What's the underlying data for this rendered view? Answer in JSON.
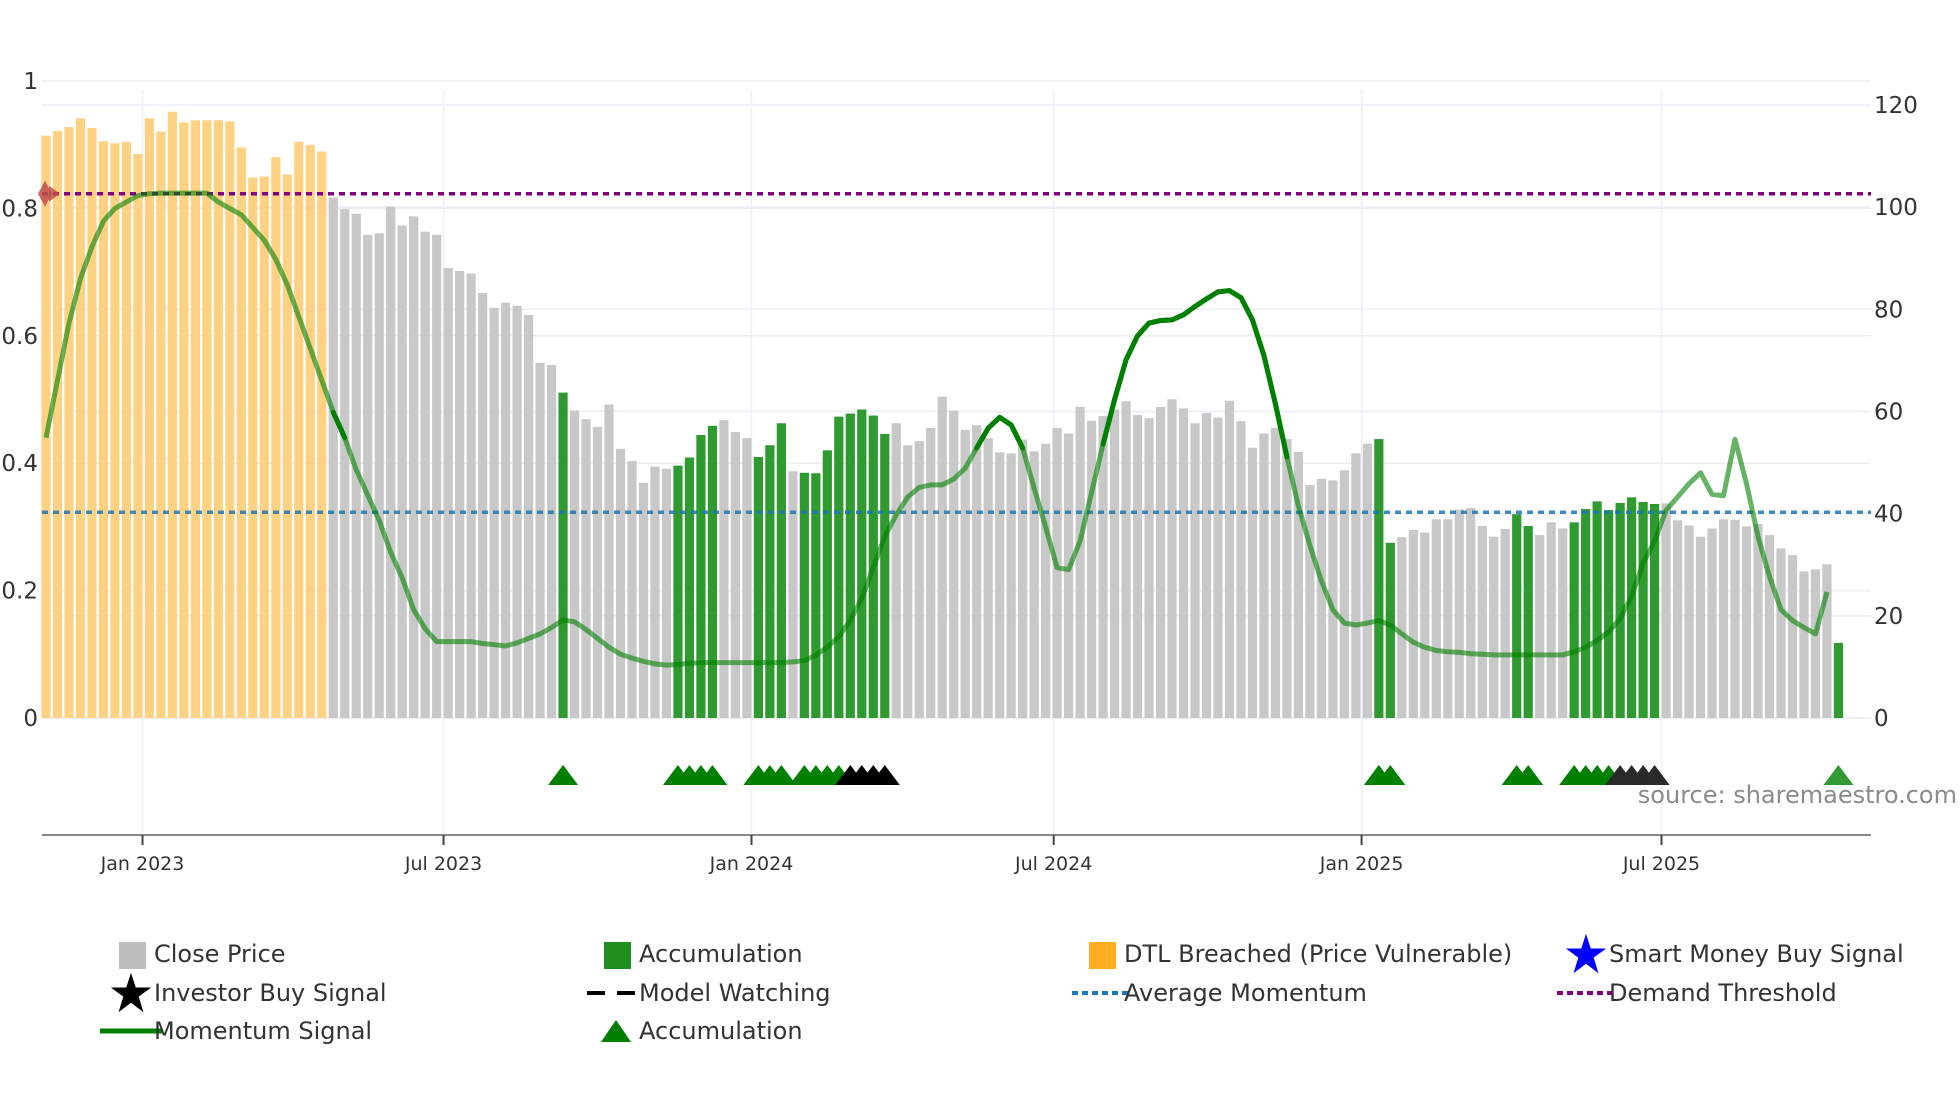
{
  "chart_data": {
    "type": "bar",
    "title": "",
    "x_unit": "week index",
    "x_ticks": [
      {
        "label": "Jan 2023",
        "index": 8.4
      },
      {
        "label": "Jul 2023",
        "index": 34.6
      },
      {
        "label": "Jan 2024",
        "index": 61.4
      },
      {
        "label": "Jul 2024",
        "index": 87.7
      },
      {
        "label": "Jan 2025",
        "index": 114.5
      },
      {
        "label": "Jul 2025",
        "index": 140.6
      }
    ],
    "y_left": {
      "ylim": [
        0,
        1
      ],
      "ticks": [
        "0",
        "0.2",
        "0.4",
        "0.6",
        "0.8",
        "1"
      ],
      "tick_values": [
        0,
        0.2,
        0.4,
        0.6,
        0.8,
        1
      ]
    },
    "y_right": {
      "ylim": [
        0,
        120
      ],
      "ticks": [
        "0",
        "20",
        "40",
        "60",
        "80",
        "100",
        "120"
      ],
      "tick_values": [
        0,
        20,
        40,
        60,
        80,
        100,
        120
      ]
    },
    "close_price": [
      114.0,
      114.9,
      115.7,
      117.4,
      115.5,
      112.9,
      112.5,
      112.8,
      110.4,
      117.4,
      114.8,
      118.7,
      116.6,
      117.0,
      117.0,
      117.0,
      116.8,
      111.7,
      105.8,
      106.0,
      109.8,
      106.4,
      112.8,
      112.2,
      110.9,
      101.9,
      99.6,
      98.7,
      94.6,
      94.9,
      100.1,
      96.4,
      98.2,
      95.2,
      94.6,
      88.1,
      87.5,
      87.0,
      83.2,
      80.3,
      81.3,
      80.7,
      78.9,
      69.5,
      69.1,
      63.7,
      60.2,
      58.5,
      57.0,
      61.4,
      52.7,
      50.3,
      46.0,
      49.2,
      48.8,
      49.4,
      51.0,
      55.4,
      57.2,
      58.3,
      56.0,
      54.8,
      51.1,
      53.4,
      57.7,
      48.3,
      48.0,
      47.9,
      52.4,
      59.0,
      59.6,
      60.4,
      59.2,
      55.6,
      57.7,
      53.4,
      54.2,
      56.8,
      62.9,
      60.2,
      56.4,
      57.3,
      54.8,
      52.0,
      51.8,
      54.5,
      52.2,
      53.7,
      56.8,
      55.7,
      60.9,
      58.2,
      59.1,
      60.4,
      62.0,
      59.3,
      58.7,
      60.9,
      62.4,
      60.6,
      57.7,
      59.7,
      58.8,
      62.1,
      58.1,
      52.9,
      55.7,
      56.8,
      54.6,
      52.1,
      45.6,
      46.8,
      46.5,
      48.5,
      51.8,
      53.7,
      54.6,
      34.3,
      35.4,
      36.8,
      36.3,
      38.9,
      38.9,
      40.8,
      41.1,
      37.6,
      35.5,
      37.0,
      39.9,
      37.6,
      35.8,
      38.3,
      37.1,
      38.3,
      40.9,
      42.4,
      40.7,
      42.1,
      43.2,
      42.3,
      41.9,
      42.0,
      38.7,
      37.7,
      35.5,
      37.1,
      38.9,
      38.8,
      37.5,
      38.0,
      35.8,
      33.2,
      31.9,
      28.7,
      29.1,
      30.1,
      14.7
    ],
    "dtl_breached_indices_range": [
      0,
      24
    ],
    "accumulation_indices": [
      45,
      55,
      56,
      57,
      58,
      62,
      63,
      64,
      66,
      67,
      68,
      69,
      70,
      71,
      72,
      73,
      116,
      117,
      128,
      129,
      133,
      134,
      135,
      136,
      137,
      138,
      139,
      140,
      156
    ],
    "investor_buy_indices": [
      70,
      71,
      72,
      73,
      137,
      138,
      139,
      140
    ],
    "momentum": [
      0.44,
      0.53,
      0.62,
      0.69,
      0.74,
      0.78,
      0.8,
      0.81,
      0.82,
      0.823,
      0.824,
      0.824,
      0.824,
      0.824,
      0.824,
      0.81,
      0.8,
      0.79,
      0.77,
      0.75,
      0.72,
      0.68,
      0.63,
      0.58,
      0.53,
      0.48,
      0.44,
      0.39,
      0.35,
      0.31,
      0.26,
      0.22,
      0.17,
      0.14,
      0.12,
      0.12,
      0.12,
      0.12,
      0.117,
      0.115,
      0.113,
      0.118,
      0.125,
      0.132,
      0.142,
      0.154,
      0.151,
      0.139,
      0.125,
      0.111,
      0.1,
      0.094,
      0.089,
      0.085,
      0.083,
      0.084,
      0.086,
      0.087,
      0.087,
      0.087,
      0.087,
      0.087,
      0.087,
      0.087,
      0.087,
      0.088,
      0.09,
      0.099,
      0.111,
      0.128,
      0.153,
      0.188,
      0.236,
      0.285,
      0.319,
      0.347,
      0.362,
      0.366,
      0.366,
      0.375,
      0.392,
      0.424,
      0.455,
      0.472,
      0.46,
      0.424,
      0.361,
      0.3,
      0.236,
      0.233,
      0.278,
      0.354,
      0.43,
      0.5,
      0.5625,
      0.6,
      0.62,
      0.624,
      0.625,
      0.633,
      0.646,
      0.658,
      0.669,
      0.671,
      0.66,
      0.625,
      0.569,
      0.493,
      0.41,
      0.333,
      0.271,
      0.215,
      0.17,
      0.149,
      0.146,
      0.149,
      0.153,
      0.146,
      0.132,
      0.119,
      0.111,
      0.106,
      0.104,
      0.103,
      0.101,
      0.1,
      0.099,
      0.099,
      0.099,
      0.099,
      0.099,
      0.099,
      0.099,
      0.104,
      0.111,
      0.122,
      0.135,
      0.156,
      0.191,
      0.243,
      0.278,
      0.326,
      0.347,
      0.368,
      0.385,
      0.351,
      0.349,
      0.4375,
      0.368,
      0.285,
      0.222,
      0.17,
      0.153,
      0.142,
      0.132,
      0.198
    ],
    "average_momentum": 0.323,
    "demand_threshold": 0.823,
    "source": "source: sharemaestro.com",
    "legend_placement": "bottom"
  },
  "colors": {
    "close": "#c8c8c8",
    "accumulation": "#2f9a2f",
    "dtl": "#ffd283",
    "momentum": "#008000",
    "average": "#1f77b4",
    "demand": "#800080",
    "investor": "#000000",
    "smart_money": "#0000ff",
    "marker": "#c0504d"
  },
  "legend": [
    {
      "label": "Close Price",
      "icon": "gray-square-icon"
    },
    {
      "label": "Accumulation",
      "icon": "green-square-icon"
    },
    {
      "label": "DTL Breached (Price Vulnerable)",
      "icon": "orange-square-icon"
    },
    {
      "label": "Smart Money Buy Signal",
      "icon": "blue-star-icon"
    },
    {
      "label": "Investor Buy Signal",
      "icon": "black-star-icon"
    },
    {
      "label": "Model Watching",
      "icon": "dashed-line-icon"
    },
    {
      "label": "Average Momentum",
      "icon": "blue-dotted-line-icon"
    },
    {
      "label": "Demand Threshold",
      "icon": "purple-dotted-line-icon"
    },
    {
      "label": "Momentum Signal",
      "icon": "green-line-icon"
    },
    {
      "label": "Accumulation",
      "icon": "green-triangle-icon"
    }
  ]
}
